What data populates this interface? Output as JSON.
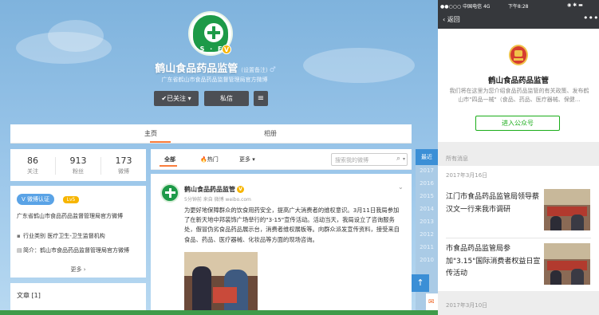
{
  "profile": {
    "name": "鹤山食品药品监管",
    "remark": "(设置备注)",
    "gender_icon": "♂",
    "description": "广东省鹤山市食品药品监督管理局官方微博",
    "avatar_text": "S · FI",
    "verified_mark": "V"
  },
  "actions": {
    "follow_label": "✔已关注 ▾",
    "message_label": "私信",
    "menu_icon": "≡"
  },
  "tabs": [
    "主页",
    "相册"
  ],
  "stats": [
    {
      "value": "86",
      "label": "关注"
    },
    {
      "value": "913",
      "label": "粉丝"
    },
    {
      "value": "173",
      "label": "微博"
    }
  ],
  "info": {
    "verify_tag": "V 微博认证",
    "level_tag": "Lv5",
    "verify_text": "广东省鹤山市食品药品监督管理局官方微博",
    "industry": "行业类别  医疗卫生-卫生监督机构",
    "intro": "简介：鹤山市食品药品监督管理局官方微博",
    "more": "更多 ›"
  },
  "articles": {
    "title": "文章 [1]"
  },
  "feed": {
    "tabs": [
      "全部",
      "热门",
      "更多 ▾"
    ],
    "hot_icon": "🔥",
    "search_placeholder": "搜索我的微博",
    "search_icon": "⌕",
    "search_drop": "▾"
  },
  "post": {
    "author": "鹤山食品药品监管",
    "time": "5分钟前 来自 微博 weibo.com",
    "text": "为更好地保障群众的饮食用药安全，提高广大消费者的维权意识。3月11日我局参加了在新天地中邦装饰广场举行的\"3·15\"宣传活动。活动当天，我局设立了咨询服务处，假冒伪劣食品药品展示台，消费者维权展板等。向群众派发宣传资料，接受来自食品、药品、医疗器械、化妆品等方面的现场咨询。",
    "chevron": "⌄"
  },
  "side": {
    "latest": "最近",
    "years": [
      "2017",
      "2016",
      "2015",
      "2014",
      "2013",
      "2012",
      "2011",
      "2010"
    ],
    "up_arrow": "↑",
    "mail_icon": "✉"
  },
  "phone": {
    "status_left": "●●○○○ 中国电信  4G",
    "status_time": "下午8:28",
    "status_right": "◉ ✱ ▬",
    "back": "‹ 返回",
    "more": "•••",
    "account_name": "鹤山食品药品监管",
    "account_desc": "我们将在这里为您介绍食品药品监管的有关政策、发布鹤山市\"四品一械\"（食品、药品、医疗器械、保健…",
    "enter_button": "进入公众号",
    "all_messages": "所有消息",
    "date1": "2017年3月16日",
    "article1": "江门市食品药品监管局领导蔡汉文一行来我市调研",
    "article2": "市食品药品监管局参加\"3.15\"国际消费者权益日宣传活动",
    "date2": "2017年3月10日"
  }
}
